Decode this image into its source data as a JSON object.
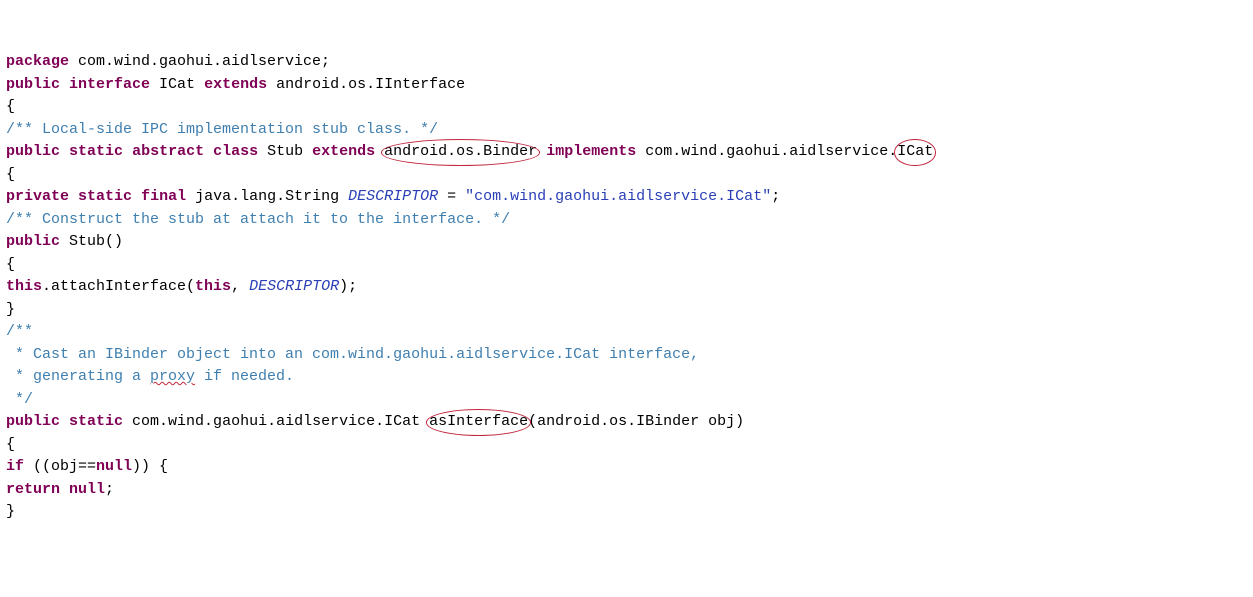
{
  "code": {
    "l1": {
      "kw1": "package",
      "t1": " com.wind.gaohui.aidlservice;"
    },
    "l2": {
      "kw1": "public",
      "kw2": "interface",
      "t1": " ICat ",
      "kw3": "extends",
      "t2": " android.os.IInterface"
    },
    "l3": "{",
    "l4": "/** Local-side IPC implementation stub class. */",
    "l5": {
      "kw1": "public",
      "kw2": "static",
      "kw3": "abstract",
      "kw4": "class",
      "t1": " Stub ",
      "kw5": "extends",
      "t2a": " ",
      "t2b": "android.os.Binder",
      "t2c": " ",
      "kw6": "implements",
      "t3a": " com.wind.gaohui.aidlservice.",
      "t3b": "ICat"
    },
    "l6": "{",
    "l7": {
      "kw1": "private",
      "kw2": "static",
      "kw3": "final",
      "t1": " java.lang.String ",
      "it1": "DESCRIPTOR",
      "t2": " = ",
      "s1": "\"com.wind.gaohui.aidlservice.ICat\"",
      "t3": ";"
    },
    "l8": "/** Construct the stub at attach it to the interface. */",
    "l9": {
      "kw1": "public",
      "t1": " Stub()"
    },
    "l10": "{",
    "l11": {
      "kw1": "this",
      "t1": ".attachInterface(",
      "kw2": "this",
      "t2": ", ",
      "it1": "DESCRIPTOR",
      "t3": ");"
    },
    "l12": "}",
    "l13a": "/**",
    "l13b": " * Cast an IBinder object into an com.wind.gaohui.aidlservice.ICat interface,",
    "l13c1": " * generating a ",
    "l13c2": "proxy",
    "l13c3": " if needed.",
    "l13d": " */",
    "l14": {
      "kw1": "public",
      "kw2": "static",
      "t1": " com.wind.gaohui.aidlservice.ICat ",
      "t2": "asInterface",
      "t3": "(android.os.IBinder obj)"
    },
    "l15": "{",
    "l16": {
      "kw1": "if",
      "t1": " ((obj==",
      "kw2": "null",
      "t2": ")) {"
    },
    "l17": {
      "kw1": "return",
      "kw2": "null",
      "t1": ";"
    },
    "l18": "}"
  }
}
